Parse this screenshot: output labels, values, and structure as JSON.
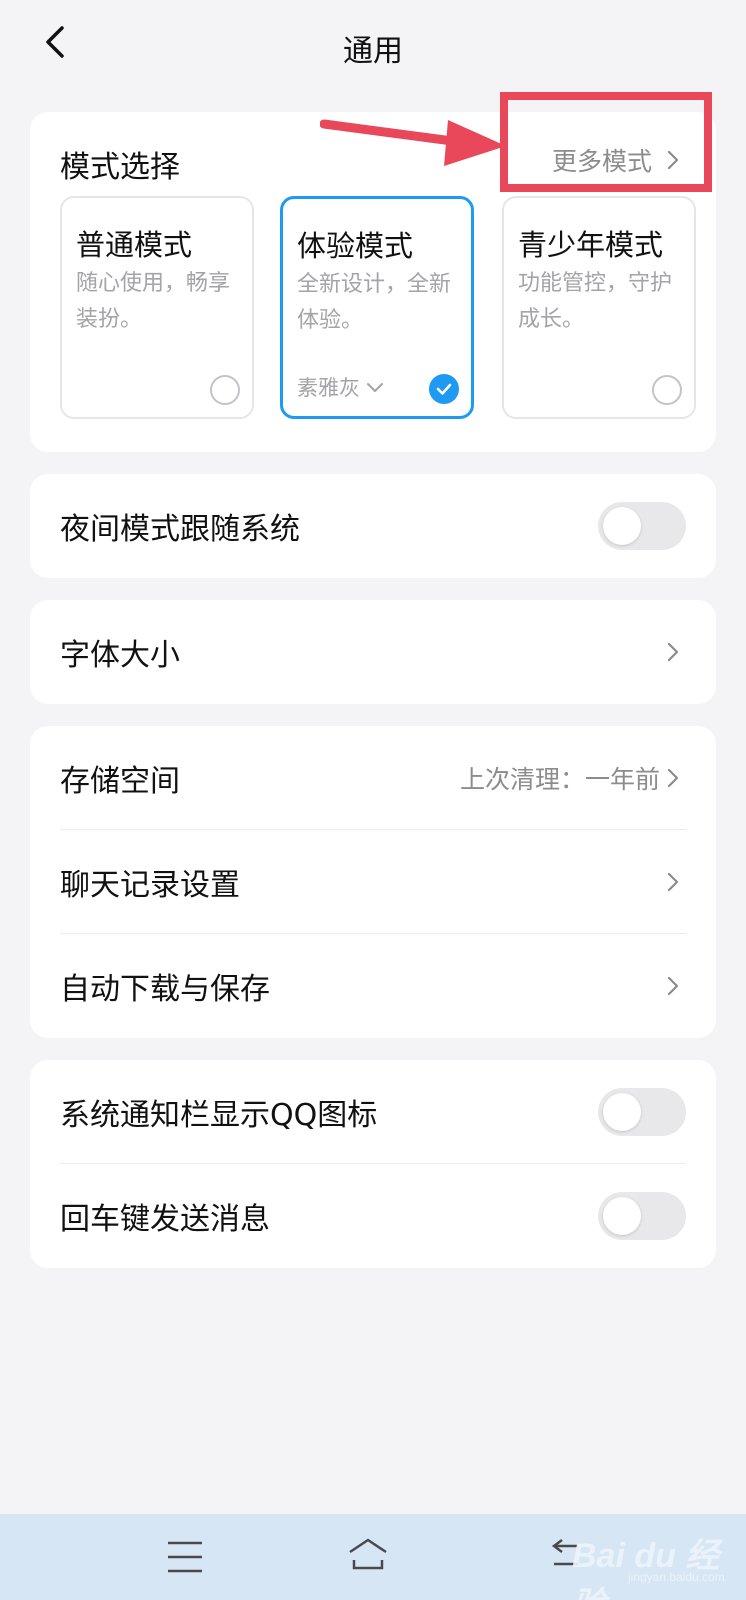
{
  "header": {
    "title": "通用"
  },
  "mode_section": {
    "title": "模式选择",
    "more_label": "更多模式",
    "modes": [
      {
        "name": "普通模式",
        "desc": "随心使用，畅享装扮。",
        "selected": false
      },
      {
        "name": "体验模式",
        "desc": "全新设计，全新体验。",
        "selected": true,
        "theme": "素雅灰"
      },
      {
        "name": "青少年模式",
        "desc": "功能管控，守护成长。",
        "selected": false
      }
    ]
  },
  "night_mode": {
    "label": "夜间模式跟随系统",
    "on": false
  },
  "font_size": {
    "label": "字体大小"
  },
  "storage": {
    "label": "存储空间",
    "value": "上次清理：一年前"
  },
  "chat_history": {
    "label": "聊天记录设置"
  },
  "auto_download": {
    "label": "自动下载与保存"
  },
  "notify_icon": {
    "label": "系统通知栏显示QQ图标",
    "on": false
  },
  "enter_send": {
    "label": "回车键发送消息",
    "on": false
  },
  "colors": {
    "accent": "#1e9af2",
    "annotation": "#e8485a",
    "navbar": "#d6e6f4"
  },
  "watermark": {
    "logo": "Bai du 经验",
    "site": "jingyan.baidu.com"
  }
}
